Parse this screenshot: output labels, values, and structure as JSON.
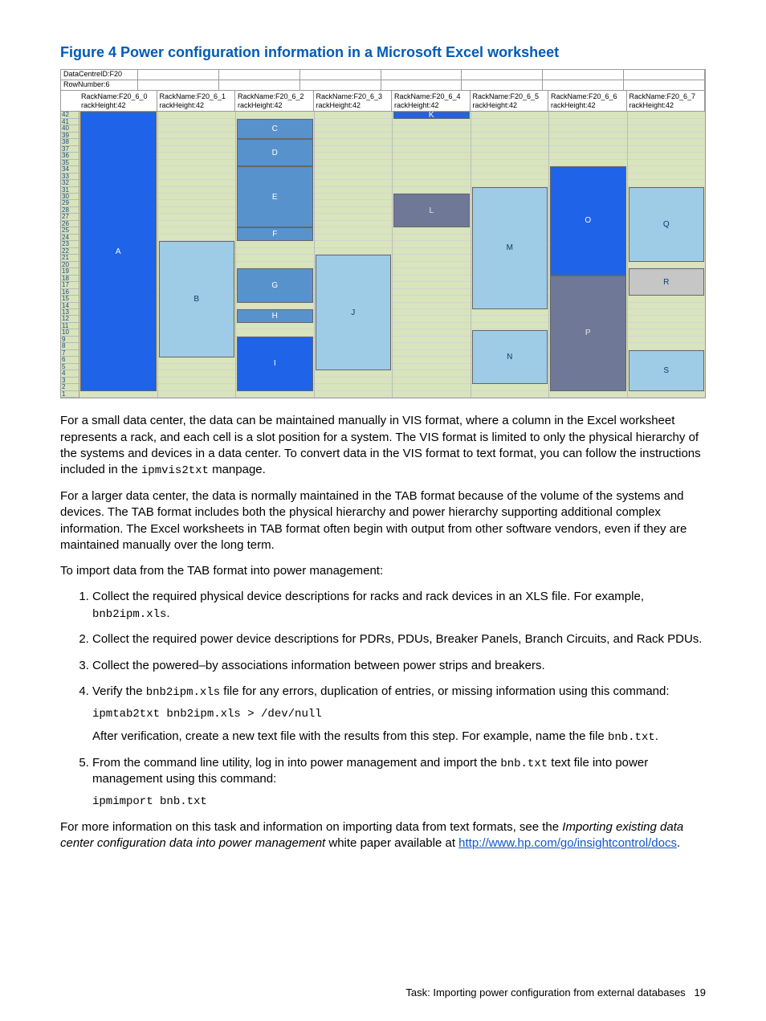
{
  "figure": {
    "title": "Figure 4 Power configuration information in a Microsoft Excel worksheet",
    "dataCentre": "DataCentreID:F20",
    "rowNumber": "RowNumber:6",
    "headers": [
      {
        "name": "RackName:F20_6_0",
        "height": "rackHeight:42"
      },
      {
        "name": "RackName:F20_6_1",
        "height": "rackHeight:42"
      },
      {
        "name": "RackName:F20_6_2",
        "height": "rackHeight:42"
      },
      {
        "name": "RackName:F20_6_3",
        "height": "rackHeight:42"
      },
      {
        "name": "RackName:F20_6_4",
        "height": "rackHeight:42"
      },
      {
        "name": "RackName:F20_6_5",
        "height": "rackHeight:42"
      },
      {
        "name": "RackName:F20_6_6",
        "height": "rackHeight:42"
      },
      {
        "name": "RackName:F20_6_7",
        "height": "rackHeight:42"
      }
    ],
    "row_labels": [
      "42",
      "41",
      "40",
      "39",
      "38",
      "37",
      "36",
      "35",
      "34",
      "33",
      "32",
      "31",
      "30",
      "29",
      "28",
      "27",
      "26",
      "25",
      "24",
      "23",
      "22",
      "21",
      "20",
      "19",
      "18",
      "17",
      "16",
      "15",
      "14",
      "13",
      "12",
      "11",
      "10",
      "9",
      "8",
      "7",
      "6",
      "5",
      "4",
      "3",
      "2",
      "1"
    ],
    "blocks": {
      "A": "A",
      "B": "B",
      "C": "C",
      "D": "D",
      "E": "E",
      "F": "F",
      "G": "G",
      "H": "H",
      "I": "I",
      "J": "J",
      "K": "K",
      "L": "L",
      "M": "M",
      "N": "N",
      "O": "O",
      "P": "P",
      "Q": "Q",
      "R": "R",
      "S": "S"
    }
  },
  "chart_data": {
    "type": "table",
    "title": "Power configuration information in a Microsoft Excel worksheet",
    "data_centre_id": "F20",
    "row_number": 6,
    "rack_height": 42,
    "racks": [
      {
        "column": "F20_6_0",
        "devices": [
          {
            "label": "A",
            "top_u": 42,
            "bottom_u": 2,
            "color": "bright-blue"
          }
        ]
      },
      {
        "column": "F20_6_1",
        "devices": [
          {
            "label": "B",
            "top_u": 23,
            "bottom_u": 7,
            "color": "light-blue"
          }
        ]
      },
      {
        "column": "F20_6_2",
        "devices": [
          {
            "label": "C",
            "top_u": 41,
            "bottom_u": 39,
            "color": "mid-blue"
          },
          {
            "label": "D",
            "top_u": 38,
            "bottom_u": 35,
            "color": "mid-blue"
          },
          {
            "label": "E",
            "top_u": 34,
            "bottom_u": 26,
            "color": "mid-blue"
          },
          {
            "label": "F",
            "top_u": 25,
            "bottom_u": 24,
            "color": "mid-blue"
          },
          {
            "label": "G",
            "top_u": 19,
            "bottom_u": 15,
            "color": "mid-blue"
          },
          {
            "label": "H",
            "top_u": 13,
            "bottom_u": 12,
            "color": "mid-blue"
          },
          {
            "label": "I",
            "top_u": 9,
            "bottom_u": 2,
            "color": "bright-blue"
          }
        ]
      },
      {
        "column": "F20_6_3",
        "devices": [
          {
            "label": "J",
            "top_u": 21,
            "bottom_u": 5,
            "color": "light-blue"
          }
        ]
      },
      {
        "column": "F20_6_4",
        "devices": [
          {
            "label": "K",
            "top_u": 42,
            "bottom_u": 42,
            "color": "bright-blue"
          },
          {
            "label": "L",
            "top_u": 30,
            "bottom_u": 26,
            "color": "slate"
          }
        ]
      },
      {
        "column": "F20_6_5",
        "devices": [
          {
            "label": "M",
            "top_u": 31,
            "bottom_u": 14,
            "color": "light-blue"
          },
          {
            "label": "N",
            "top_u": 10,
            "bottom_u": 3,
            "color": "light-blue"
          }
        ]
      },
      {
        "column": "F20_6_6",
        "devices": [
          {
            "label": "O",
            "top_u": 34,
            "bottom_u": 19,
            "color": "bright-blue"
          },
          {
            "label": "P",
            "top_u": 18,
            "bottom_u": 2,
            "color": "slate"
          }
        ]
      },
      {
        "column": "F20_6_7",
        "devices": [
          {
            "label": "Q",
            "top_u": 31,
            "bottom_u": 21,
            "color": "light-blue"
          },
          {
            "label": "R",
            "top_u": 19,
            "bottom_u": 16,
            "color": "grey"
          },
          {
            "label": "S",
            "top_u": 7,
            "bottom_u": 2,
            "color": "light-blue"
          }
        ]
      }
    ]
  },
  "body": {
    "p1a": "For a small data center, the data can be maintained manually in VIS format, where a column in the Excel worksheet represents a rack, and each cell is a slot position for a system. The VIS format is limited to only the physical hierarchy of the systems and devices in a data center. To convert data in the VIS format to text format, you can follow the instructions included in the ",
    "p1_code": "ipmvis2txt",
    "p1b": " manpage.",
    "p2": "For a larger data center, the data is normally maintained in the TAB format because of the volume of the systems and devices. The TAB format includes both the physical hierarchy and power hierarchy supporting additional complex information. The Excel worksheets in TAB format often begin with output from other software vendors, even if they are maintained manually over the long term.",
    "p3": "To import data from the TAB format into power management:",
    "steps": {
      "s1a": "Collect the required physical device descriptions for racks and rack devices in an XLS file. For example, ",
      "s1_code": "bnb2ipm.xls",
      "s1b": ".",
      "s2": "Collect the required power device descriptions for PDRs, PDUs, Breaker Panels, Branch Circuits, and Rack PDUs.",
      "s3": "Collect the powered–by associations information between power strips and breakers.",
      "s4a": "Verify the ",
      "s4_code1": "bnb2ipm.xls",
      "s4b": " file for any errors, duplication of entries, or missing information using this command:",
      "s4_cmd": "ipmtab2txt bnb2ipm.xls > /dev/null",
      "s4c": "After verification, create a new text file with the results from this step. For example, name the file ",
      "s4_code2": "bnb.txt",
      "s4d": ".",
      "s5a": "From the command line utility, log in into power management and import the ",
      "s5_code": "bnb.txt",
      "s5b": " text file into power management using this command:",
      "s5_cmd": "ipmimport bnb.txt"
    },
    "p4a": "For more information on this task and information on importing data from text formats, see the ",
    "p4_italic": "Importing existing data center configuration data into power management",
    "p4b": " white paper available at ",
    "p4_link": "http://www.hp.com/go/insightcontrol/docs",
    "p4c": "."
  },
  "footer": {
    "task": "Task: Importing power configuration from external databases",
    "page": "19"
  }
}
